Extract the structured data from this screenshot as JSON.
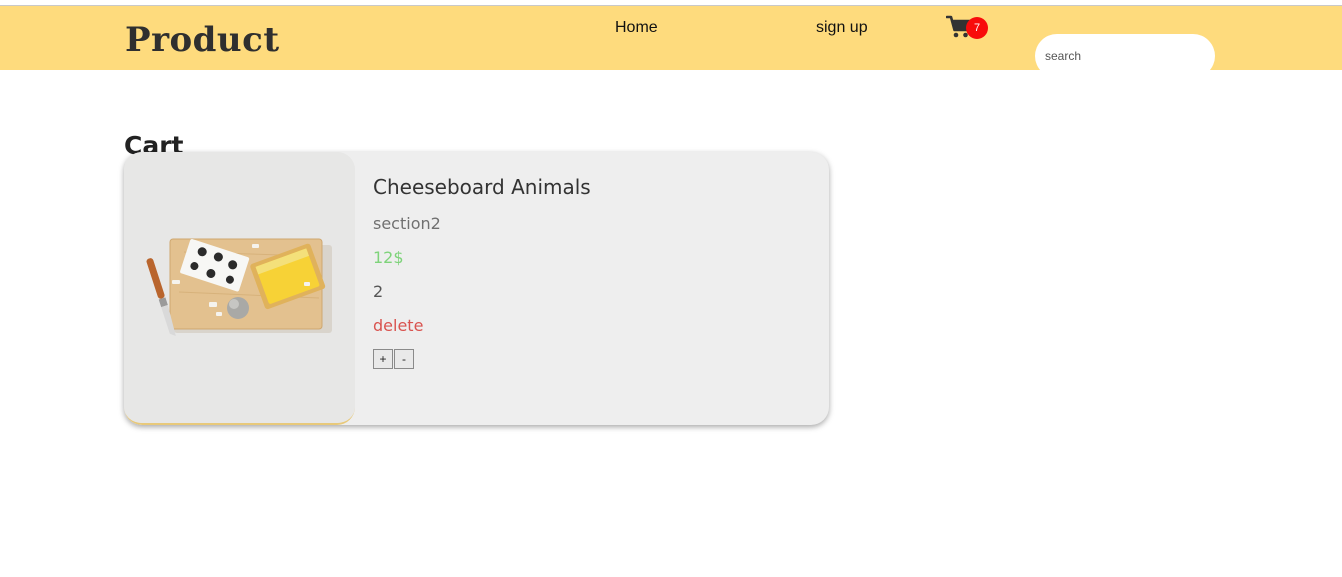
{
  "navbar": {
    "brand": "Product",
    "links": [
      {
        "label": "Home"
      },
      {
        "label": "sign up"
      }
    ],
    "cart": {
      "icon": "cart-icon",
      "badge_count": "7",
      "badge_color": "#f80b0b"
    },
    "search": {
      "placeholder": "search",
      "value": ""
    },
    "background_color": "#fedb7d"
  },
  "main": {
    "title": "Cart",
    "items": [
      {
        "name": "Cheeseboard Animals",
        "section": "section2",
        "price": "12$",
        "quantity": "2",
        "delete_label": "delete",
        "plus_label": "+",
        "minus_label": "-",
        "image": "cheeseboard-image"
      }
    ]
  },
  "colors": {
    "price": "#7ed37a",
    "delete": "#d9534f",
    "card_background": "#eeeeee"
  }
}
